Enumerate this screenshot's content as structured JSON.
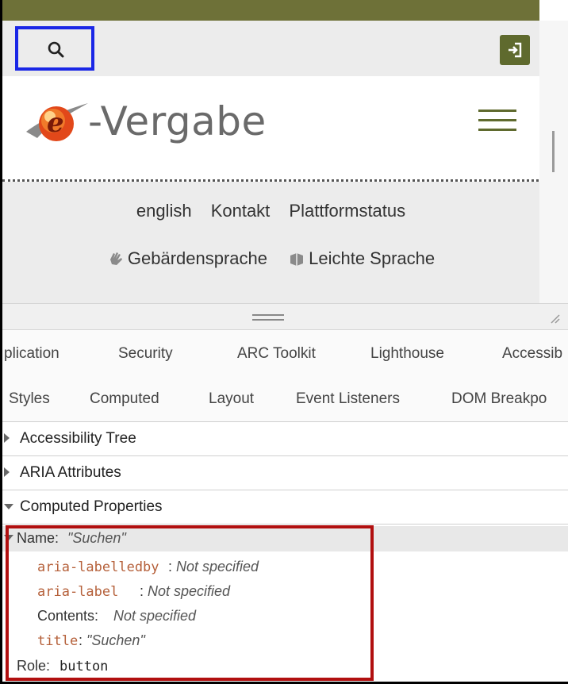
{
  "site": {
    "logo_text": "-Vergabe",
    "logo_letter": "e",
    "search_label": "search-icon",
    "login_label": "login-icon",
    "nav_links": [
      "english",
      "Kontakt",
      "Plattformstatus"
    ],
    "lang_links": {
      "sign_language": "Gebärdensprache",
      "easy_language": "Leichte Sprache"
    },
    "colors": {
      "olive": "#6e7138",
      "search_highlight": "#1a27e6",
      "props_highlight": "#b10f0f"
    }
  },
  "devtools": {
    "tabs": [
      "plication",
      "Security",
      "ARC Toolkit",
      "Lighthouse",
      "Accessib"
    ],
    "subtabs": [
      "Styles",
      "Computed",
      "Layout",
      "Event Listeners",
      "DOM Breakpo"
    ],
    "sections": [
      "Accessibility Tree",
      "ARIA Attributes",
      "Computed Properties"
    ],
    "computed": {
      "name_label": "Name: ",
      "name_value": "\"Suchen\"",
      "aria_labelledby": "aria-labelledby",
      "aria_labelledby_value": "Not specified",
      "aria_label": "aria-label",
      "aria_label_value": "Not specified",
      "contents_label": "Contents: ",
      "contents_value": "Not specified",
      "title_attr": "title",
      "title_value": "\"Suchen\"",
      "role_label": "Role: ",
      "role_value": "button"
    }
  }
}
